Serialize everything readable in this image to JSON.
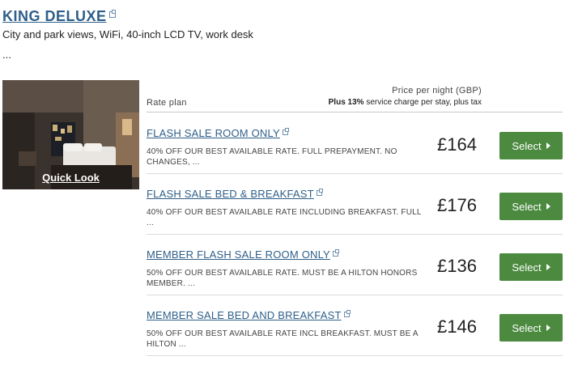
{
  "room": {
    "title": "KING DELUXE",
    "description": "City and park views, WiFi, 40-inch LCD TV, work desk",
    "more": "...",
    "quick_look": "Quick Look"
  },
  "header": {
    "rate_plan": "Rate plan",
    "price_label": "Price per night (GBP)",
    "tax_bold": "Plus 13%",
    "tax_rest": " service charge per stay, plus tax"
  },
  "rates": [
    {
      "name": "FLASH SALE ROOM ONLY",
      "description": "40% OFF OUR BEST AVAILABLE RATE. FULL PREPAYMENT. NO CHANGES, ...",
      "price": "£164",
      "button": "Select"
    },
    {
      "name": "FLASH SALE BED & BREAKFAST",
      "description": "40% OFF OUR BEST AVAILABLE RATE INCLUDING BREAKFAST. FULL ...",
      "price": "£176",
      "button": "Select"
    },
    {
      "name": "MEMBER FLASH SALE ROOM ONLY",
      "description": "50% OFF OUR BEST AVAILABLE RATE. MUST BE A HILTON HONORS MEMBER. ...",
      "price": "£136",
      "button": "Select"
    },
    {
      "name": "MEMBER SALE BED AND BREAKFAST",
      "description": "50% OFF OUR BEST AVAILABLE RATE INCL BREAKFAST. MUST BE A HILTON ...",
      "price": "£146",
      "button": "Select"
    }
  ],
  "colors": {
    "link": "#2e5f8a",
    "select_button": "#4b8a3f"
  },
  "icons": {
    "external_link": "external-link-icon",
    "button_arrow": "arrow-right-icon"
  }
}
